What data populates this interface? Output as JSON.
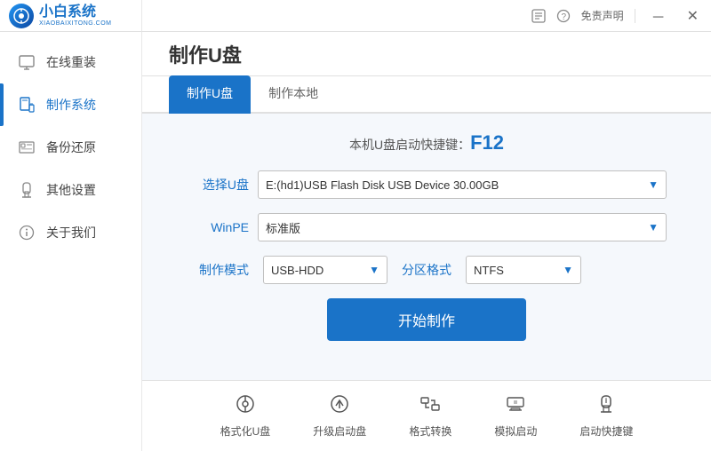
{
  "app": {
    "title": "制作U盘",
    "logo_main": "小白系统",
    "logo_sub": "XIAOBAIXITONG.COM",
    "free_statement": "免责声明"
  },
  "sidebar": {
    "items": [
      {
        "id": "online-reinstall",
        "label": "在线重装",
        "icon": "🖥"
      },
      {
        "id": "make-system",
        "label": "制作系统",
        "icon": "💾"
      },
      {
        "id": "backup-restore",
        "label": "备份还原",
        "icon": "⊞"
      },
      {
        "id": "other-settings",
        "label": "其他设置",
        "icon": "🔒"
      },
      {
        "id": "about-us",
        "label": "关于我们",
        "icon": "ℹ"
      }
    ]
  },
  "tabs": [
    {
      "id": "make-udisk",
      "label": "制作U盘",
      "active": true
    },
    {
      "id": "make-local",
      "label": "制作本地",
      "active": false
    }
  ],
  "form": {
    "shortcut_prefix": "本机U盘启动快捷键：",
    "shortcut_key": "F12",
    "select_udisk_label": "选择U盘",
    "select_udisk_value": "E:(hd1)USB Flash Disk USB Device 30.00GB",
    "winpe_label": "WinPE",
    "winpe_value": "标准版",
    "make_mode_label": "制作模式",
    "make_mode_value": "USB-HDD",
    "partition_label": "分区格式",
    "partition_value": "NTFS",
    "start_btn_label": "开始制作"
  },
  "bottom_tools": [
    {
      "id": "format-udisk",
      "label": "格式化U盘",
      "icon": "⊙"
    },
    {
      "id": "upgrade-boot",
      "label": "升级启动盘",
      "icon": "⊕"
    },
    {
      "id": "format-convert",
      "label": "格式转换",
      "icon": "⇄"
    },
    {
      "id": "simulate-boot",
      "label": "模拟启动",
      "icon": "⊞"
    },
    {
      "id": "boot-shortcut",
      "label": "启动快捷键",
      "icon": "🔒"
    }
  ],
  "colors": {
    "accent": "#1a73c8",
    "text_primary": "#333",
    "text_secondary": "#666"
  }
}
